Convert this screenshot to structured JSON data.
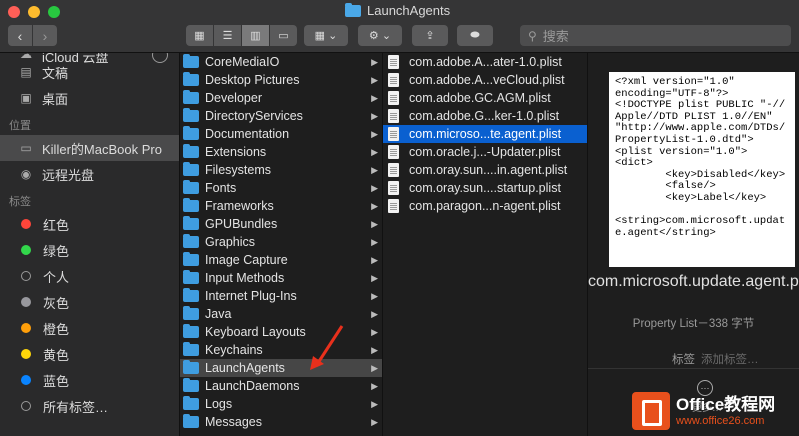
{
  "window": {
    "title": "LaunchAgents"
  },
  "toolbar": {
    "back": "‹",
    "forward": "›",
    "search_placeholder": "搜索"
  },
  "sidebar": {
    "icloud_label": "iCloud 云盘",
    "items_top": [
      {
        "label": "文稿",
        "icon": "document-icon"
      },
      {
        "label": "桌面",
        "icon": "desktop-icon"
      }
    ],
    "locations_header": "位置",
    "locations": [
      {
        "label": "Killer的MacBook Pro",
        "icon": "laptop-icon",
        "selected": true
      },
      {
        "label": "远程光盘",
        "icon": "disc-icon"
      }
    ],
    "tags_header": "标签",
    "tags": [
      {
        "label": "红色",
        "color": "#ff453a"
      },
      {
        "label": "绿色",
        "color": "#32d74b"
      },
      {
        "label": "个人",
        "color": "none"
      },
      {
        "label": "灰色",
        "color": "#98989d"
      },
      {
        "label": "橙色",
        "color": "#ff9f0a"
      },
      {
        "label": "黄色",
        "color": "#ffd60a"
      },
      {
        "label": "蓝色",
        "color": "#0a84ff"
      },
      {
        "label": "所有标签…",
        "color": "none"
      }
    ]
  },
  "column1": [
    "CoreMediaIO",
    "Desktop Pictures",
    "Developer",
    "DirectoryServices",
    "Documentation",
    "Extensions",
    "Filesystems",
    "Fonts",
    "Frameworks",
    "GPUBundles",
    "Graphics",
    "Image Capture",
    "Input Methods",
    "Internet Plug-Ins",
    "Java",
    "Keyboard Layouts",
    "Keychains",
    "LaunchAgents",
    "LaunchDaemons",
    "Logs",
    "Messages"
  ],
  "column1_highlight": "LaunchAgents",
  "column2": [
    "com.adobe.A...ater-1.0.plist",
    "com.adobe.A...veCloud.plist",
    "com.adobe.GC.AGM.plist",
    "com.adobe.G...ker-1.0.plist",
    "com.microso...te.agent.plist",
    "com.oracle.j...-Updater.plist",
    "com.oray.sun....in.agent.plist",
    "com.oray.sun....startup.plist",
    "com.paragon...n-agent.plist"
  ],
  "column2_selected": "com.microso...te.agent.plist",
  "preview": {
    "content": "<?xml version=\"1.0\"\nencoding=\"UTF-8\"?>\n<!DOCTYPE plist PUBLIC \"-//\nApple//DTD PLIST 1.0//EN\"\n\"http://www.apple.com/DTDs/\nPropertyList-1.0.dtd\">\n<plist version=\"1.0\">\n<dict>\n        <key>Disabled</key>\n        <false/>\n        <key>Label</key>\n\n<string>com.microsoft.updat\ne.agent</string>",
    "name": "com.microsoft.update.agent.plist",
    "meta": "Property List－338 字节",
    "tags_label": "标签",
    "tags_placeholder": "添加标签…",
    "more_label": "更多…"
  },
  "watermark": {
    "title": "Office教程网",
    "url": "www.office26.com"
  }
}
